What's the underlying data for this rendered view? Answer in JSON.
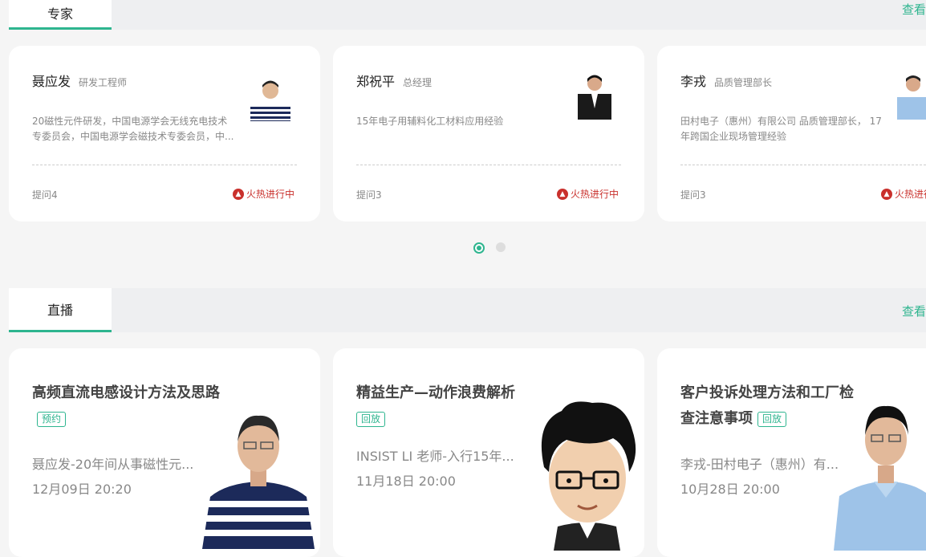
{
  "experts_section": {
    "tab_label": "专家",
    "more_label": "查看更多"
  },
  "experts": [
    {
      "name": "聂应发",
      "title": "研发工程师",
      "desc": "20磁性元件研发，中国电源学会无线充电技术专委员会，中国电源学会磁技术专委会员，中...",
      "questions": "提问4",
      "status": "火热进行中"
    },
    {
      "name": "郑祝平",
      "title": "总经理",
      "desc": "15年电子用辅料化工材料应用经验",
      "questions": "提问3",
      "status": "火热进行中"
    },
    {
      "name": "李戎",
      "title": "品质管理部长",
      "desc": "田村电子（惠州）有限公司 品质管理部长， 17年跨国企业现场管理经验",
      "questions": "提问3",
      "status": "火热进行中"
    }
  ],
  "pagination": {
    "active": 1,
    "total": 2,
    "active_color": "#2eb58f",
    "inactive_color": "#dddddd"
  },
  "live_section": {
    "tab_label": "直播",
    "more_label": "查看更多"
  },
  "lives": [
    {
      "title": "高频直流电感设计方法及思路",
      "badge": "预约",
      "desc": "聂应发-20年间从事磁性元...",
      "time": "12月09日 20:20"
    },
    {
      "title": "精益生产—动作浪费解析",
      "badge": "回放",
      "desc": "INSIST LI 老师-入行15年...",
      "time": "11月18日 20:00"
    },
    {
      "title": "客户投诉处理方法和工厂检查注意事项",
      "badge": "回放",
      "desc": "李戎-田村电子（惠州）有...",
      "time": "10月28日 20:00"
    }
  ],
  "colors": {
    "accent": "#2eb58f",
    "hot": "#c9302c"
  }
}
